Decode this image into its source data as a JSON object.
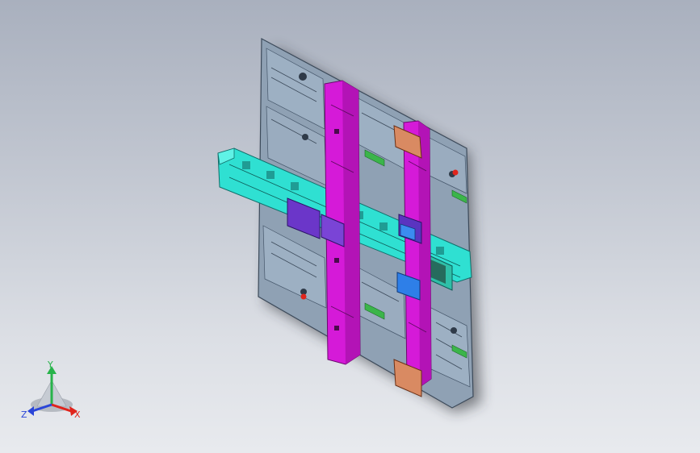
{
  "viewport": {
    "background_top": "#a9b0be",
    "background_bottom": "#e8eaee"
  },
  "model": {
    "colors": {
      "base_plate": "#8fa1b4",
      "base_plate_edge": "#3c4a5a",
      "upright": "#d51ad8",
      "crossbeam": "#2fe0d2",
      "block_purple": "#6b36c9",
      "block_blue": "#2e7fe8",
      "clamp_copper": "#d98a62",
      "pad_green": "#3bb54a",
      "pin_red": "#e0241c"
    }
  },
  "triad": {
    "y_label": "Y",
    "x_label": "X",
    "z_label": "Z",
    "x_color": "#e0241c",
    "y_color": "#27b34a",
    "z_color": "#2a45d8"
  }
}
